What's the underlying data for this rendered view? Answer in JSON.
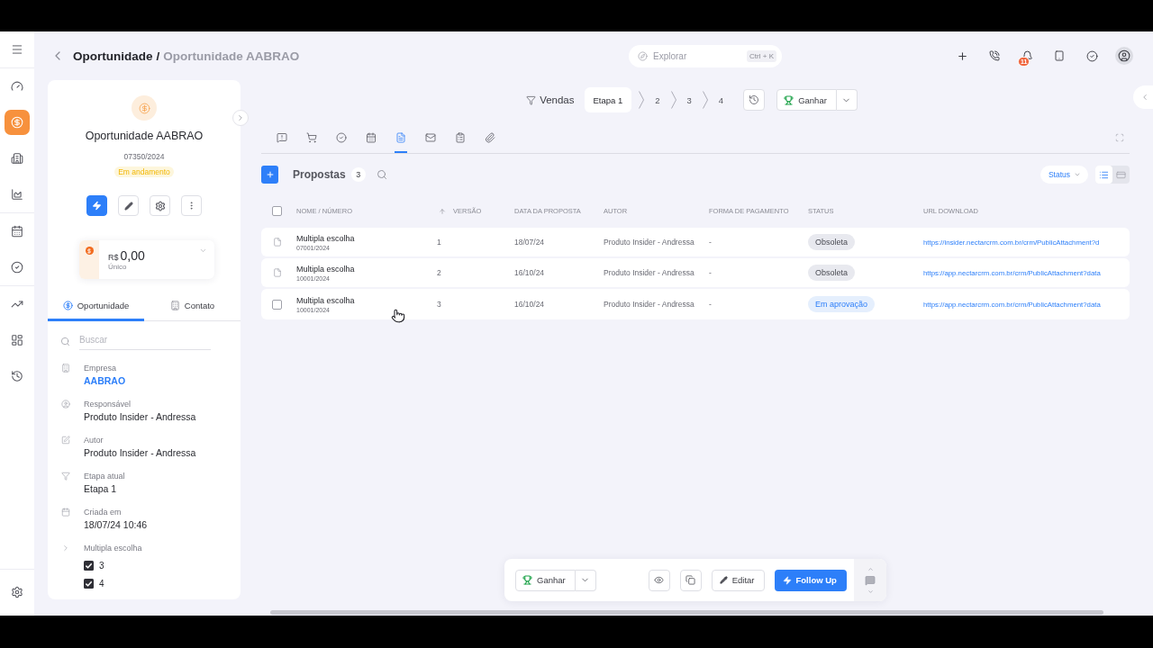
{
  "nav": {
    "items": [
      {
        "selected": false
      },
      {
        "selected": true
      },
      {
        "selected": false
      },
      {
        "selected": false
      },
      {
        "selected": false
      },
      {
        "selected": false
      },
      {
        "selected": false
      },
      {
        "selected": false
      },
      {
        "selected": false
      }
    ]
  },
  "header": {
    "breadcrumb": {
      "parent": "Oportunidade",
      "separator": "/",
      "current": "Oportunidade AABRAO"
    },
    "search": {
      "placeholder": "Explorar",
      "shortcut": "Ctrl + K"
    },
    "notification_count": "11"
  },
  "record": {
    "title": "Oportunidade AABRAO",
    "number": "07350/2024",
    "status": "Em andamento",
    "value": {
      "currency": "R$",
      "amount": "0,00",
      "recurrence": "Único"
    },
    "tabs": [
      {
        "label": "Oportunidade",
        "selected": true
      },
      {
        "label": "Contato",
        "selected": false
      }
    ],
    "search": {
      "placeholder": "Buscar"
    },
    "fields": [
      {
        "label": "Empresa",
        "value": "AABRAO",
        "kind": "link"
      },
      {
        "label": "Responsável",
        "value": "Produto Insider - Andressa",
        "kind": "text"
      },
      {
        "label": "Autor",
        "value": "Produto Insider - Andressa",
        "kind": "text"
      },
      {
        "label": "Etapa atual",
        "value": "Etapa 1",
        "kind": "text"
      },
      {
        "label": "Criada em",
        "value": "18/07/24 10:46",
        "kind": "text"
      }
    ],
    "multiple_choice": {
      "label": "Multipla escolha",
      "options": [
        {
          "label": "3",
          "checked": true
        },
        {
          "label": "4",
          "checked": true
        }
      ]
    }
  },
  "pipeline": {
    "name": "Vendas",
    "stages": [
      {
        "label": "Etapa 1",
        "selected": true
      },
      {
        "label": "2",
        "selected": false
      },
      {
        "label": "3",
        "selected": false
      },
      {
        "label": "4",
        "selected": false
      }
    ],
    "win_button": "Ganhar"
  },
  "detail_tabs": [
    {
      "selected": false
    },
    {
      "selected": false
    },
    {
      "selected": false
    },
    {
      "selected": false
    },
    {
      "selected": true
    },
    {
      "selected": false
    },
    {
      "selected": false
    },
    {
      "selected": false
    }
  ],
  "proposals": {
    "title": "Propostas",
    "count": "3",
    "status_filter": "Status",
    "views": [
      {
        "selected": true
      },
      {
        "selected": false
      }
    ],
    "select_all": {
      "checked": false
    },
    "columns": [
      {
        "label": "NOME / NÚMERO",
        "sorted": false
      },
      {
        "label": "VERSÃO",
        "sorted": true
      },
      {
        "label": "DATA DA PROPOSTA",
        "sorted": false
      },
      {
        "label": "AUTOR",
        "sorted": false
      },
      {
        "label": "FORMA DE PAGAMENTO",
        "sorted": false
      },
      {
        "label": "STATUS",
        "sorted": false
      },
      {
        "label": "URL DOWNLOAD",
        "sorted": false
      }
    ],
    "rows": [
      {
        "name": "Multipla escolha",
        "number": "07001/2024",
        "version": "1",
        "date": "18/07/24",
        "author": "Produto Insider - Andressa",
        "payment": "-",
        "status": {
          "label": "Obsoleta",
          "kind": "obsolete"
        },
        "url": "https://insider.nectarcrm.com.br/crm/PublicAttachment?d",
        "hovered": false,
        "checked": false
      },
      {
        "name": "Multipla escolha",
        "number": "10001/2024",
        "version": "2",
        "date": "16/10/24",
        "author": "Produto Insider - Andressa",
        "payment": "-",
        "status": {
          "label": "Obsoleta",
          "kind": "obsolete"
        },
        "url": "https://app.nectarcrm.com.br/crm/PublicAttachment?data",
        "hovered": false,
        "checked": false
      },
      {
        "name": "Multipla escolha",
        "number": "10001/2024",
        "version": "3",
        "date": "16/10/24",
        "author": "Produto Insider - Andressa",
        "payment": "-",
        "status": {
          "label": "Em aprovação",
          "kind": "approval"
        },
        "url": "https://app.nectarcrm.com.br/crm/PublicAttachment?data",
        "hovered": true,
        "checked": false
      }
    ]
  },
  "action_bar": {
    "win_button": "Ganhar",
    "edit_button": "Editar",
    "follow_up_button": "Follow Up"
  }
}
